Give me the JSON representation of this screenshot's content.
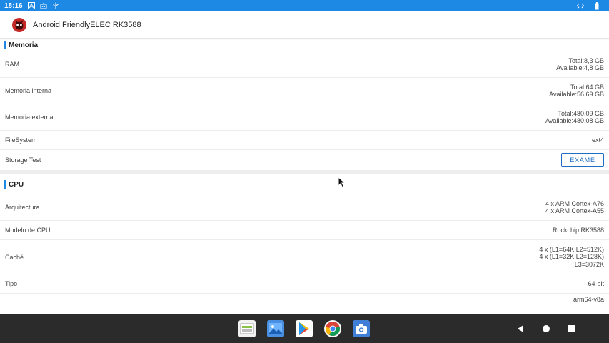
{
  "status_bar": {
    "time": "18:16"
  },
  "app_bar": {
    "title": "Android FriendlyELEC RK3588"
  },
  "memory": {
    "title": "Memoria",
    "ram": {
      "label": "RAM",
      "total": "Total:8,3 GB",
      "available": "Available:4,8 GB"
    },
    "internal": {
      "label": "Memoria interna",
      "total": "Total:64 GB",
      "available": "Available:56,69 GB"
    },
    "external": {
      "label": "Memoria externa",
      "total": "Total:480,09 GB",
      "available": "Available:480,08 GB"
    },
    "filesystem": {
      "label": "FileSystem",
      "value": "ext4"
    },
    "storage_test": {
      "label": "Storage Test",
      "button": "EXAME"
    }
  },
  "cpu": {
    "title": "CPU",
    "architecture": {
      "label": "Arquitectura",
      "line1": "4 x ARM Cortex-A76",
      "line2": "4 x ARM Cortex-A55"
    },
    "model": {
      "label": "Modelo de CPU",
      "value": "Rockchip RK3588"
    },
    "cache": {
      "label": "Caché",
      "line1": "4 x (L1=64K,L2=512K)",
      "line2": "4 x (L1=32K,L2=128K)",
      "line3": "L3=3072K"
    },
    "type": {
      "label": "Tipo",
      "value": "64-bit"
    },
    "abi": {
      "value": "arm64-v8a"
    }
  },
  "colors": {
    "status_bar": "#1e88e5",
    "accent": "#1e6fc4",
    "nav_bar": "#2b2b2b"
  },
  "dock": [
    "files-app-icon",
    "gallery-app-icon",
    "play-store-icon",
    "chrome-icon",
    "camera-app-icon"
  ],
  "nav": [
    "back-icon",
    "home-icon",
    "recents-icon"
  ]
}
